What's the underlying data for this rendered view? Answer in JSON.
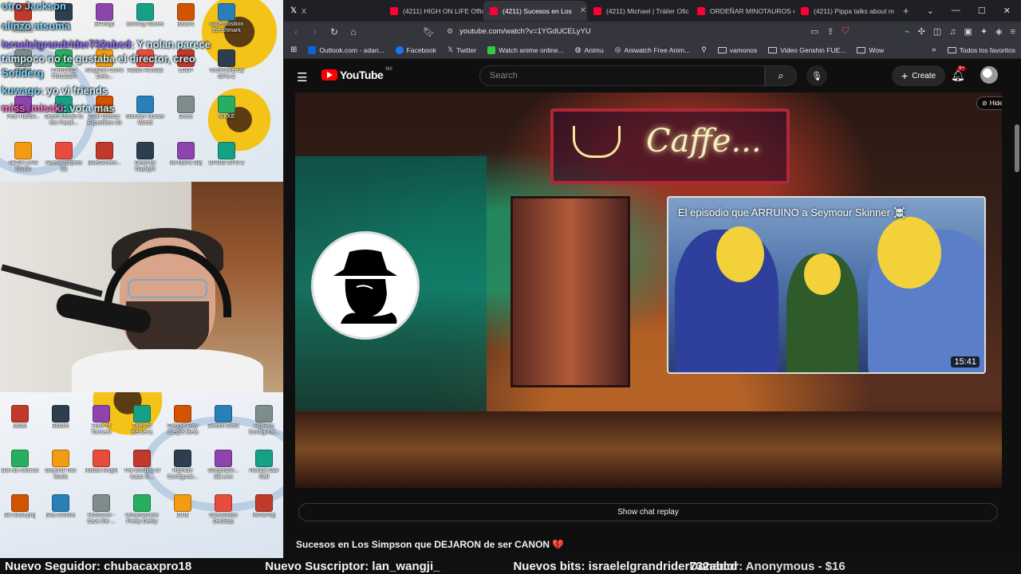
{
  "overlay": {
    "chat": [
      {
        "user": "otro Jackson",
        "text": ""
      },
      {
        "user": "alinzo atsuma",
        "text": ""
      },
      {
        "user": "israelelgrandrider732abcd",
        "text": "Y nolan parece"
      },
      {
        "user": "",
        "text": "tampoco no te gustaba el director, creo"
      },
      {
        "user": "Sotiderg",
        "text": ""
      },
      {
        "user": "kuwago",
        "text": "yo vi friends"
      },
      {
        "user": "miss_misaki",
        "text": "vota mas"
      }
    ],
    "desktop_top_icons": [
      "Balatro Roulette",
      "Brave",
      "ElAmigo",
      "Burning Waves",
      "Balatro",
      "Superposition Benchmark",
      "ecrfl.gif",
      "CHRONO TRIGGER",
      "Kingdom Come Deliv...",
      "Adobe Acrobat",
      "LOOT",
      "TechPowerUp GPU-Z",
      "Pear Hardw...",
      "Death Marsh to the Parall...",
      "Clair Obscur Expedition 33",
      "Monster Hunter World",
      "Brave",
      "NIKKE",
      "TikTok LIVE Studio",
      "Nueva carpeta (3)",
      "BlueScreen...",
      "Dead by Daylight",
      "No Man's Sky",
      "CPUID CPU-Z",
      "OBS Studio",
      "VLC media player"
    ],
    "desktop_bottom_icons": [
      "sadas",
      "Balatro",
      "Halls of Torment",
      "Tales of Berseria",
      "Google Play Juegos Beta",
      "Stream Deck",
      "HidHide Configurat...",
      "skin de nikki.txt",
      "Beyond Two Souls",
      "Hollow Knight",
      "The Binding of Isaac R...",
      "HidHide Configurat...",
      "StreamEle... SE.Live",
      "Honkai Star Rail",
      "Sin título.png",
      "Blue Archive",
      "HoloCure - Save the ...",
      "Umamusume Pretty Derby",
      "iCUE",
      "Streamlabs Desktop",
      "HoYoPlay"
    ]
  },
  "browser": {
    "tabs": [
      {
        "label": "X",
        "active": false
      },
      {
        "label": "(4211) HIGH ON LIFE Offici",
        "active": false
      },
      {
        "label": "(4211) Sucesos en Los",
        "active": true
      },
      {
        "label": "(4211) Michael | Tráiler Ofic",
        "active": false
      },
      {
        "label": "ORDEÑAR MINOTAUROS e",
        "active": false
      },
      {
        "label": "(4211) Pippa talks about m",
        "active": false
      }
    ],
    "new_tab": "+",
    "url": "youtube.com/watch?v=1YGdUCELyYU",
    "bookmarks": [
      {
        "label": "Outlook.com - adan...",
        "color": "#0a64d8"
      },
      {
        "label": "Facebook",
        "color": "#1877f2"
      },
      {
        "label": "Twitter",
        "color": "#000000"
      },
      {
        "label": "Watch anime online...",
        "color": "#2ecc40"
      },
      {
        "label": "Animu",
        "color": "#888888"
      },
      {
        "label": "Aniwatch Free Anim...",
        "color": "#888888"
      },
      {
        "label": "vamonos",
        "color": "folder"
      },
      {
        "label": "Video Genshin FUE...",
        "color": "folder"
      },
      {
        "label": "Wow",
        "color": "folder"
      }
    ],
    "all_bookmarks": "Todos los favoritos"
  },
  "youtube": {
    "logo_text": "YouTube",
    "logo_region": "MX",
    "search_placeholder": "Search",
    "create_label": "Create",
    "bell_badge": "9+",
    "hide_label": "Hide",
    "neon_text": "Caffe...",
    "endcard_title": "El episodio que ARRUINO a Seymour Skinner ☠️",
    "endcard_duration": "15:41",
    "chat_replay_label": "Show chat replay",
    "video_title": "Sucesos en Los Simpson que DEJARON de ser CANON 💔"
  },
  "ticker": {
    "items": [
      "Nuevo Seguidor: chubacaxpro18",
      "Nuevo Suscriptor: lan_wangji_",
      "Nuevos bits: israelelgrandrider732abcd",
      "Donador: Anonymous - $16"
    ]
  }
}
